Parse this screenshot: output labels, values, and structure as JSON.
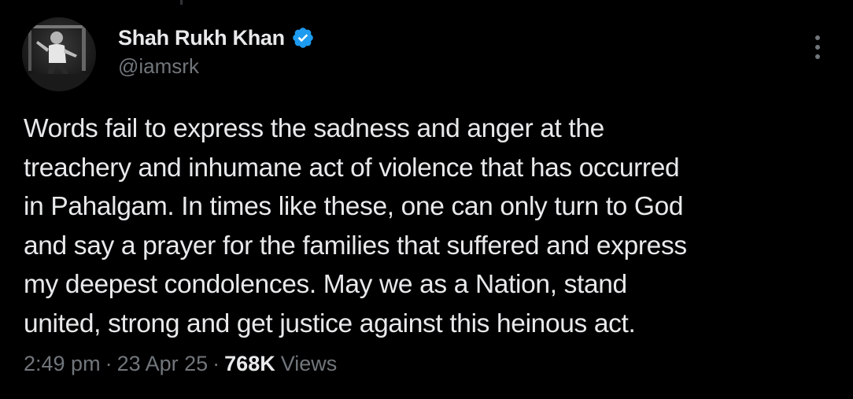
{
  "author": {
    "display_name": "Shah Rukh Khan",
    "handle": "@iamsrk",
    "verified": true,
    "avatar_icon": "profile-photo",
    "verified_icon": "verified-badge-icon"
  },
  "tweet": {
    "lines": [
      "Words fail to express the sadness and anger at the",
      "treachery and inhumane act of violence that has occurred",
      "in Pahalgam. In times like these, one can only turn to God",
      "and say a prayer for the families that suffered and express",
      "my deepest condolences. May we as a Nation, stand",
      "united, strong and get justice against this heinous act."
    ]
  },
  "meta": {
    "time": "2:49 pm",
    "separator": "·",
    "date": "23 Apr 25",
    "views_count": "768K",
    "views_label": "Views"
  },
  "colors": {
    "background": "#000000",
    "primary_text": "#e7e9ea",
    "secondary_text": "#71767b",
    "verified_blue": "#1d9bf0"
  },
  "more_menu_icon": "more-vertical-icon"
}
